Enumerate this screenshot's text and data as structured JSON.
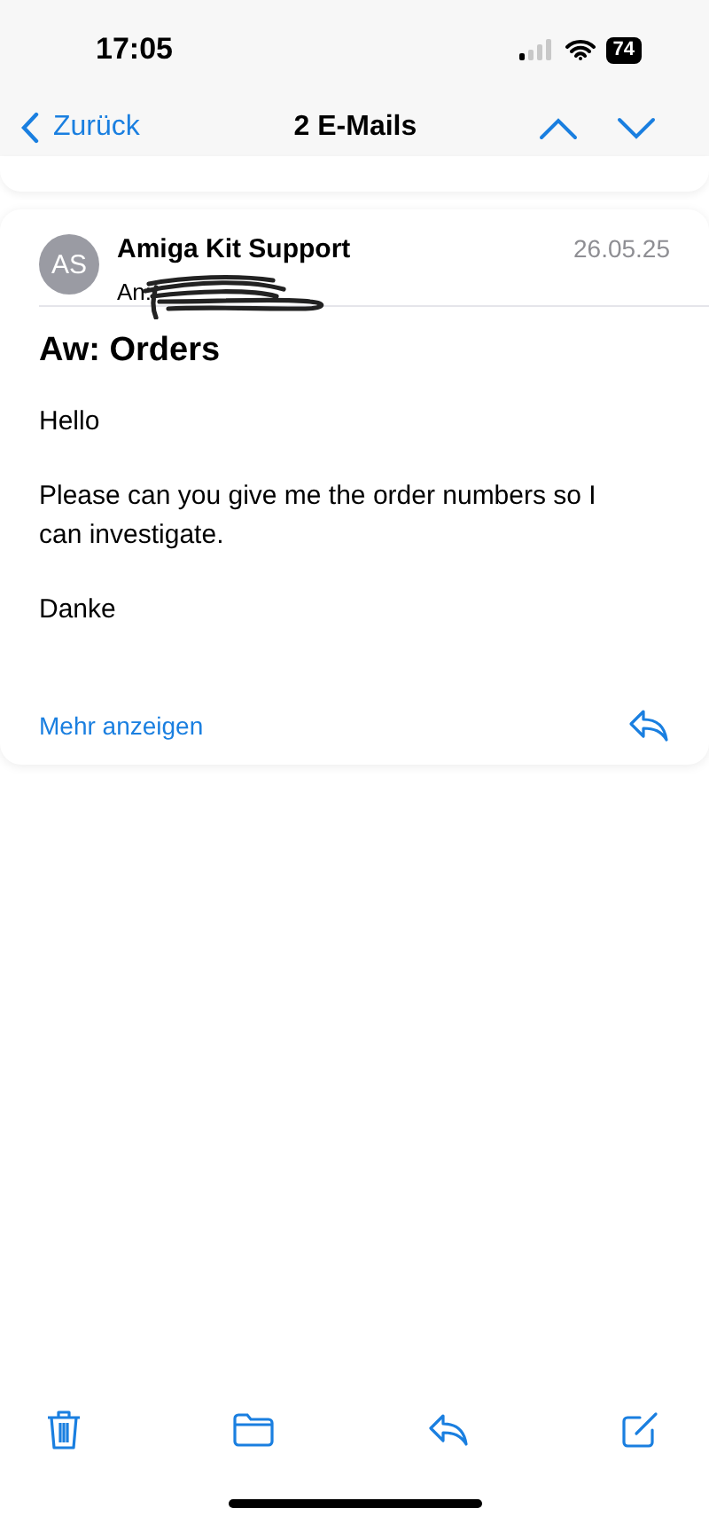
{
  "status_bar": {
    "time": "17:05",
    "battery": "74"
  },
  "nav": {
    "back": "Zurück",
    "title": "2 E-Mails"
  },
  "message": {
    "avatar": "AS",
    "sender": "Amiga Kit Support",
    "to_label": "An:",
    "date": "26.05.25",
    "subject": "Aw: Orders",
    "paragraphs": [
      "Hello",
      "Please can you give me the order numbers so I can investigate.",
      "Danke"
    ],
    "more": "Mehr anzeigen"
  }
}
